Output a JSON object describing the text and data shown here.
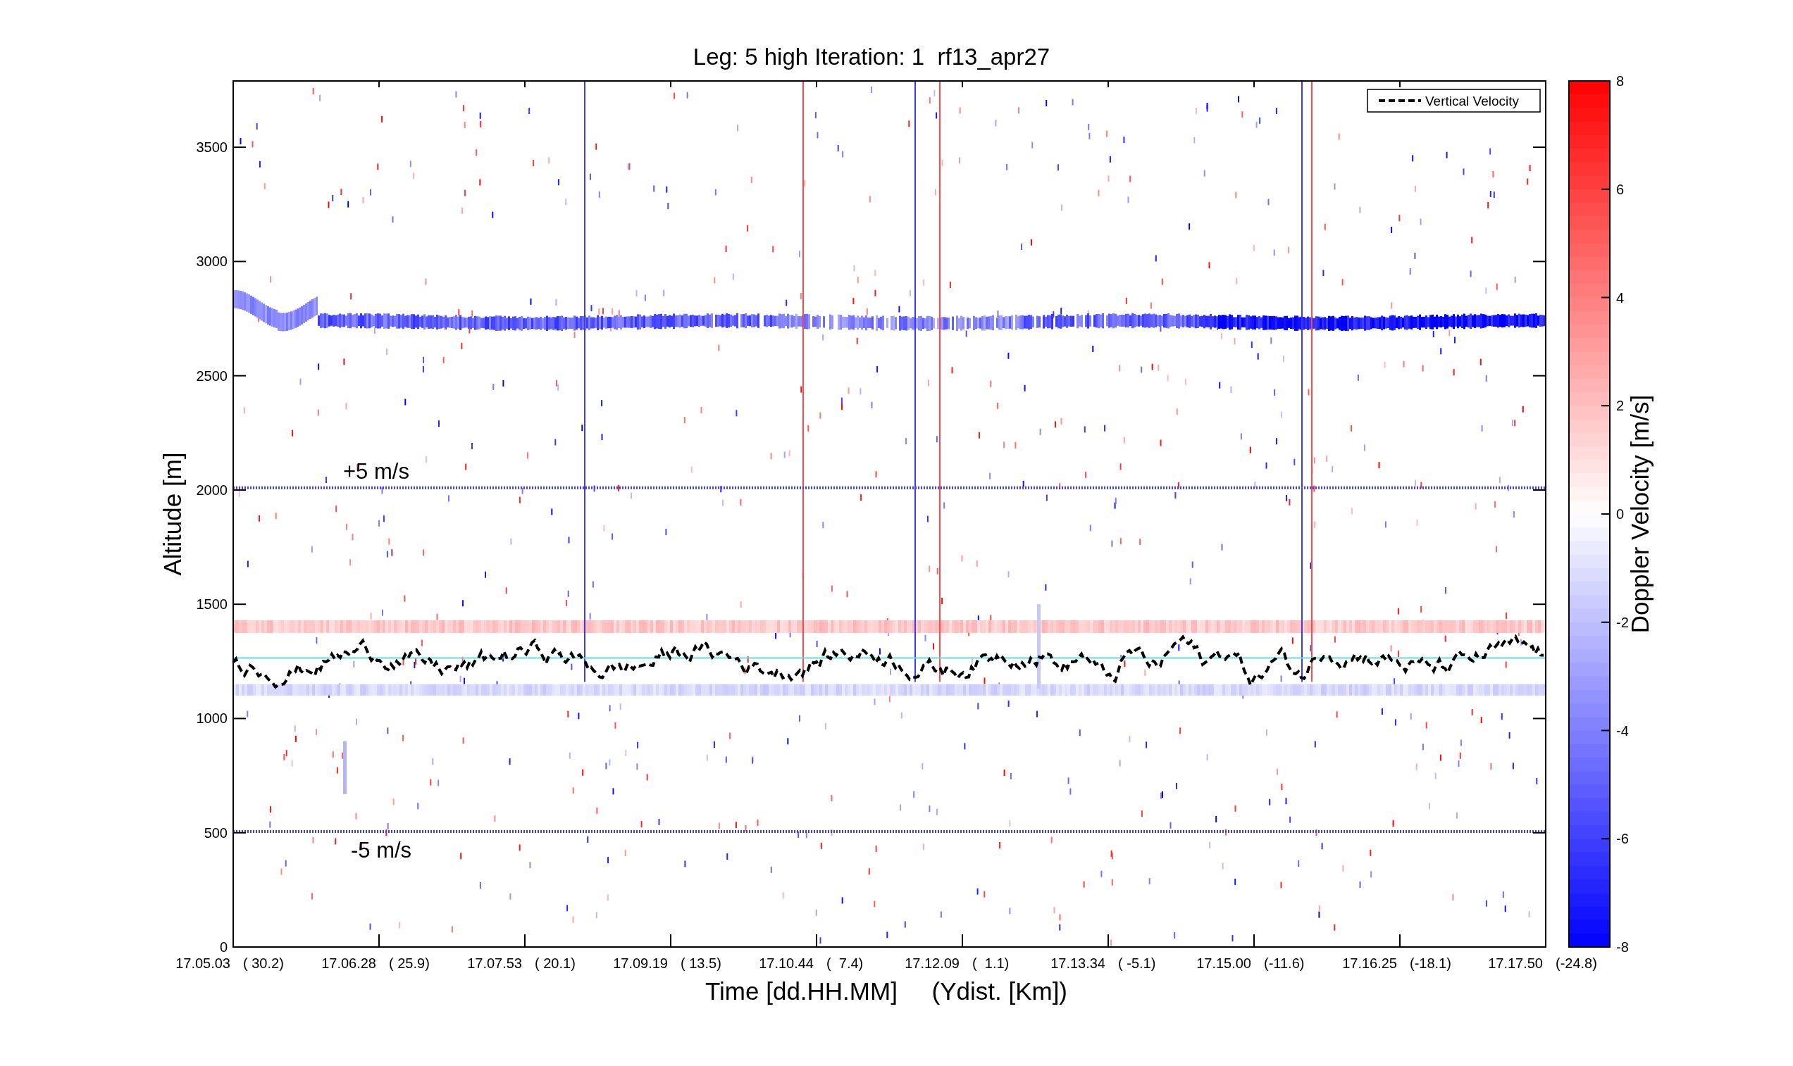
{
  "figure": {
    "title": "Leg: 5 high Iteration: 1  rf13_apr27",
    "ylabel": "Altitude [m]",
    "xlabel": "Time [dd.HH.MM]     (Ydist. [Km])",
    "y_ticks": [
      "3500",
      "3000",
      "2500",
      "2000",
      "1500",
      "1000",
      "500",
      "0"
    ],
    "x_ticks": [
      {
        "time": "17.05.03",
        "dist": "( 30.2)"
      },
      {
        "time": "17.06.28",
        "dist": "( 25.9)"
      },
      {
        "time": "17.07.53",
        "dist": "( 20.1)"
      },
      {
        "time": "17.09.19",
        "dist": "( 13.5)"
      },
      {
        "time": "17.10.44",
        "dist": "(  7.4)"
      },
      {
        "time": "17.12.09",
        "dist": "(  1.1)"
      },
      {
        "time": "17.13.34",
        "dist": "( -5.1)"
      },
      {
        "time": "17.15.00",
        "dist": "(-11.6)"
      },
      {
        "time": "17.16.25",
        "dist": "(-18.1)"
      },
      {
        "time": "17.17.50",
        "dist": "(-24.8)"
      }
    ],
    "legend": [
      {
        "label": "Vertical Velocity"
      }
    ],
    "annotations": [
      {
        "text": "+5 m/s"
      },
      {
        "text": "-5 m/s"
      }
    ]
  },
  "colorbar": {
    "label": "Doppler Velocity [m/s]",
    "ticks": [
      "8",
      "6",
      "4",
      "2",
      "0",
      "-2",
      "-4",
      "-6",
      "-8"
    ]
  }
}
